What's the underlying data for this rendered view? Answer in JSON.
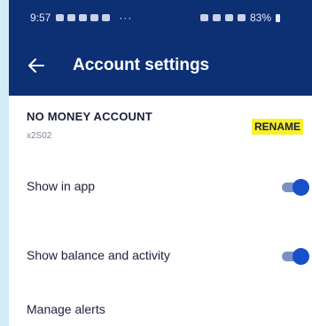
{
  "status_bar": {
    "time": "9:57",
    "dots": "···",
    "battery_text": "83%"
  },
  "header": {
    "title": "Account settings"
  },
  "account": {
    "name": "NO MONEY ACCOUNT",
    "number": "x2S02",
    "rename_label": "RENAME",
    "highlight_color": "#f7f02b"
  },
  "settings": [
    {
      "label": "Show in app",
      "enabled": true
    },
    {
      "label": "Show balance and activity",
      "enabled": true
    }
  ],
  "manage_alerts": {
    "label": "Manage alerts"
  },
  "colors": {
    "primary": "#0d2f74",
    "toggle_on": "#1750c8",
    "background": "#d4ecf7"
  }
}
